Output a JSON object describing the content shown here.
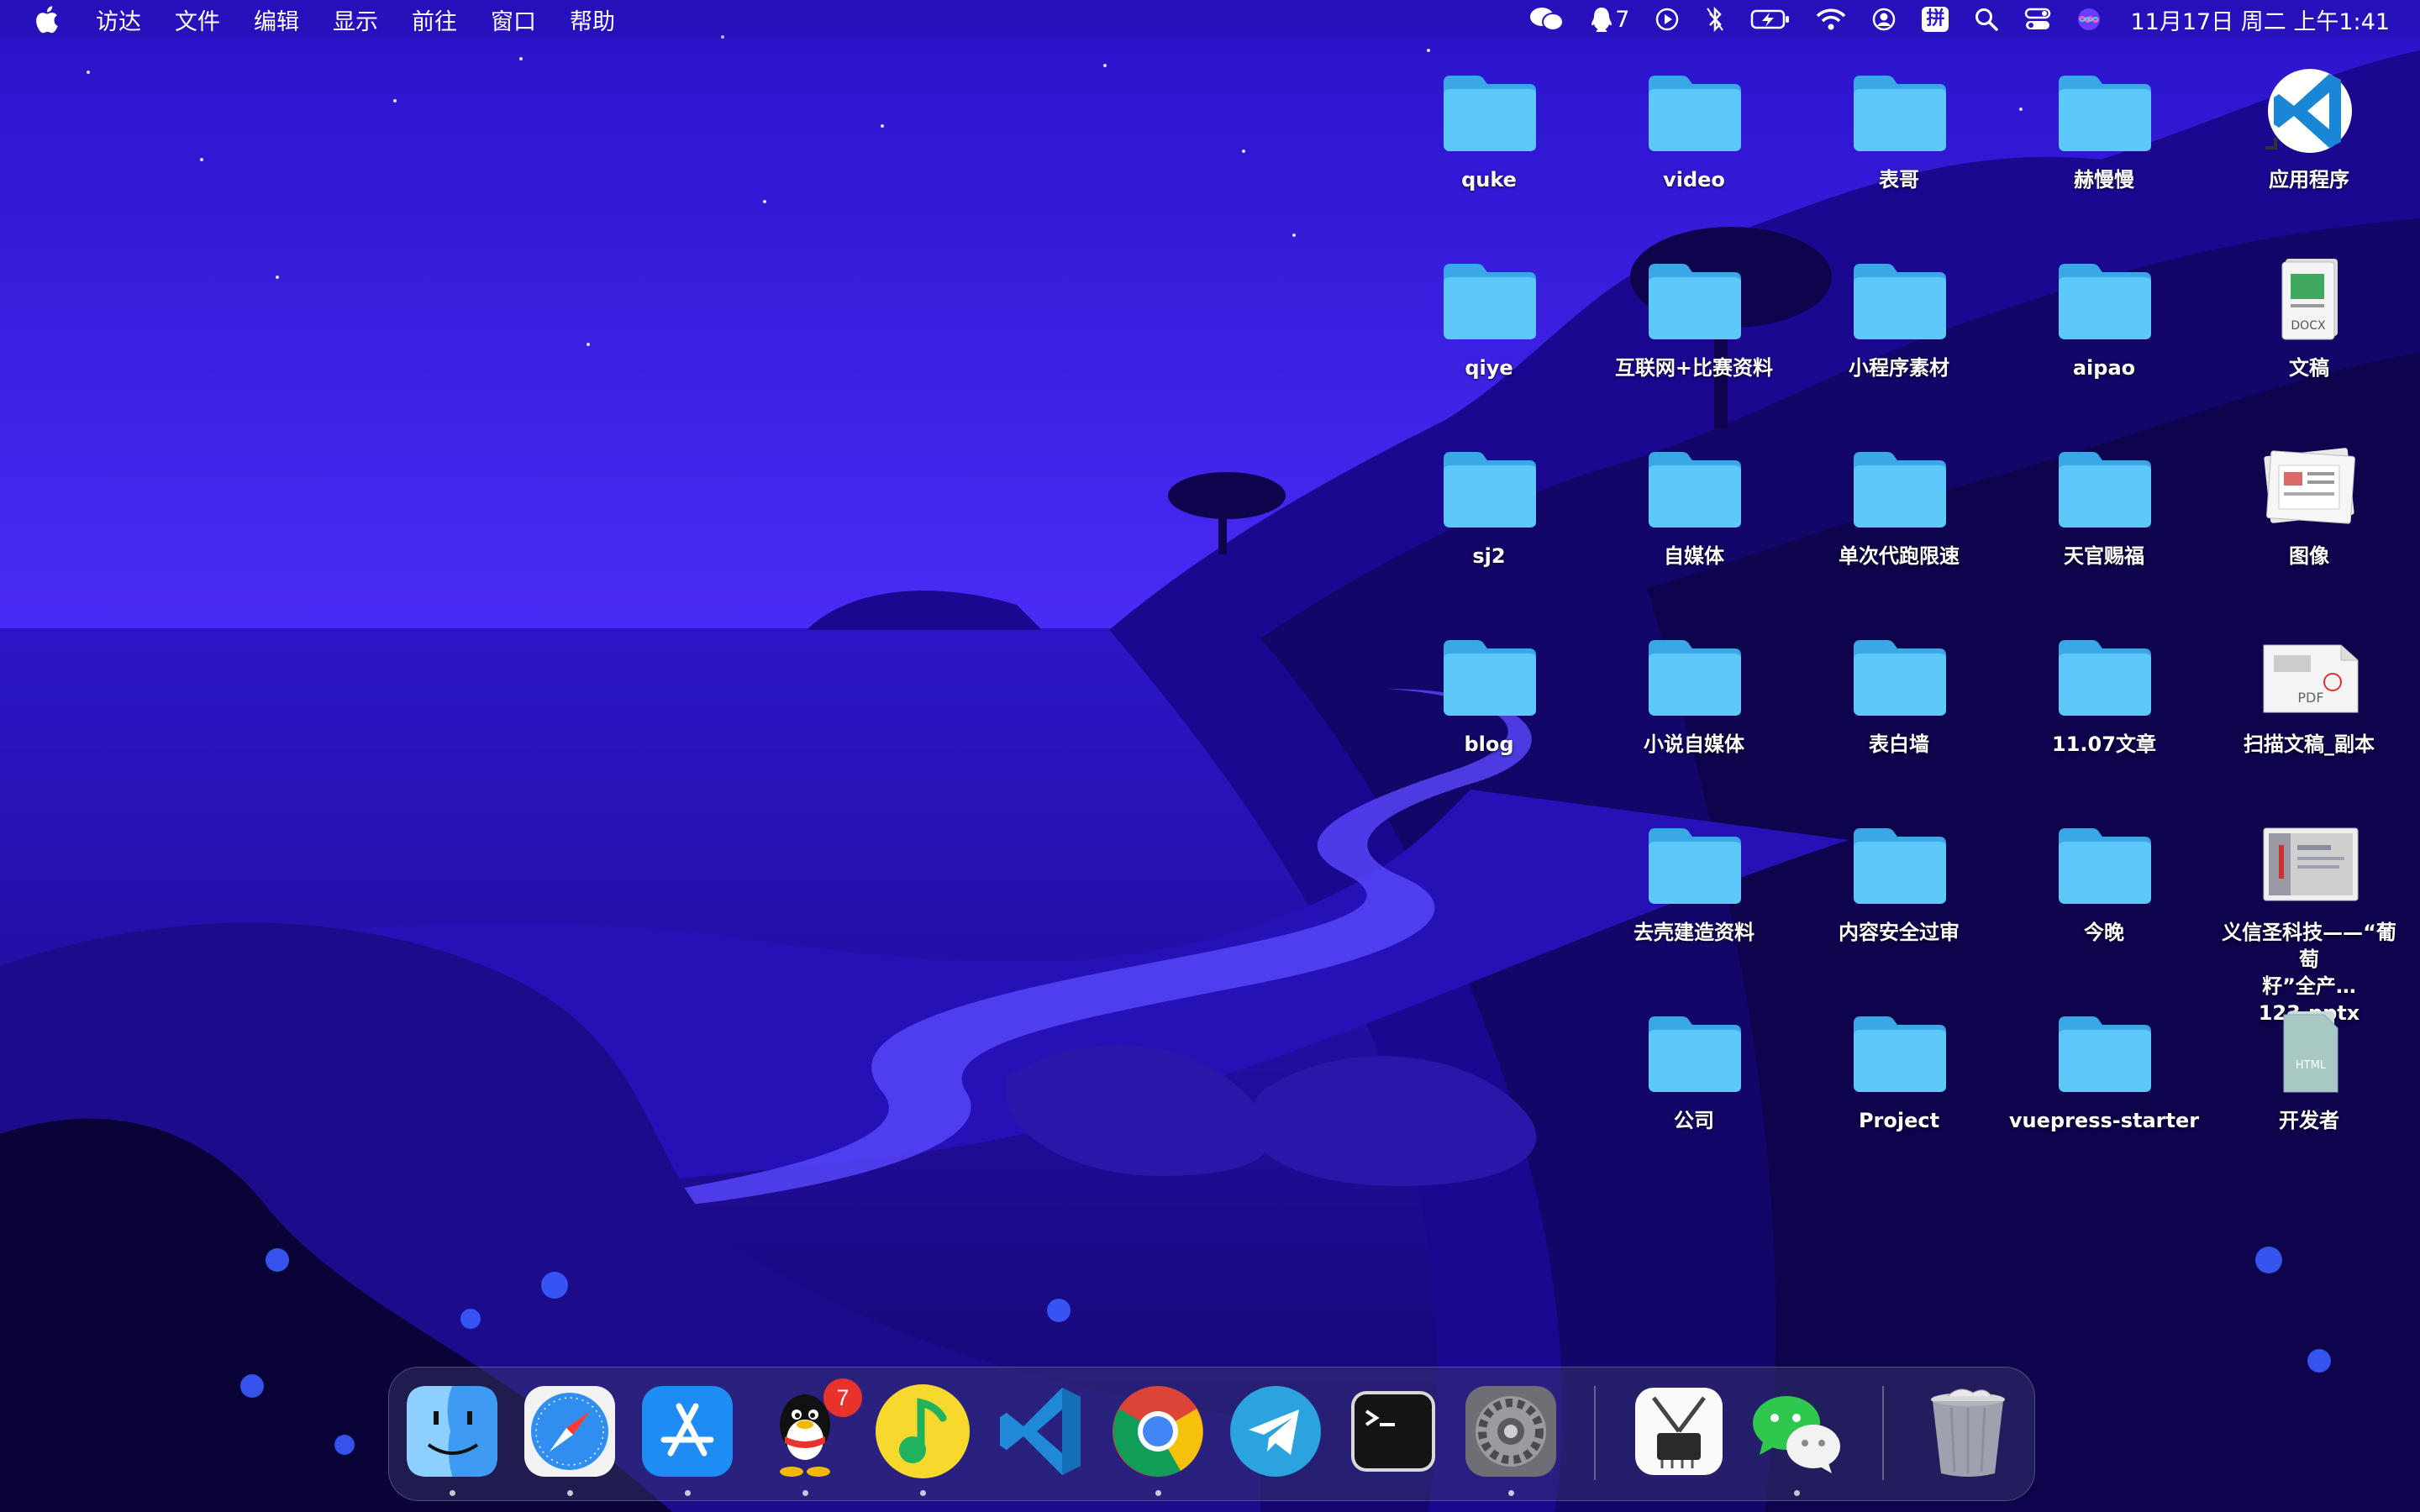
{
  "menubar": {
    "apple_icon": "apple-logo-icon",
    "menus": [
      "访达",
      "文件",
      "编辑",
      "显示",
      "前往",
      "窗口",
      "帮助"
    ],
    "status": {
      "notification_count": "7",
      "input_method": "拼",
      "datetime": "11月17日 周二 上午1:41"
    }
  },
  "desktop": {
    "items": [
      {
        "label": "quke",
        "icon": "folder-icon"
      },
      {
        "label": "video",
        "icon": "folder-icon"
      },
      {
        "label": "表哥",
        "icon": "folder-icon"
      },
      {
        "label": "赫慢慢",
        "icon": "folder-icon"
      },
      {
        "label": "应用程序",
        "icon": "vscode-alias-icon"
      },
      {
        "label": "qiye",
        "icon": "folder-icon"
      },
      {
        "label": "互联网+比赛资料",
        "icon": "folder-icon"
      },
      {
        "label": "小程序素材",
        "icon": "folder-icon"
      },
      {
        "label": "aipao",
        "icon": "folder-icon"
      },
      {
        "label": "文稿",
        "icon": "docx-stack-icon",
        "sublabel": "DOCX"
      },
      {
        "label": "sj2",
        "icon": "folder-icon"
      },
      {
        "label": "自媒体",
        "icon": "folder-icon"
      },
      {
        "label": "单次代跑限速",
        "icon": "folder-icon"
      },
      {
        "label": "天官赐福",
        "icon": "folder-icon"
      },
      {
        "label": "图像",
        "icon": "image-stack-icon"
      },
      {
        "label": "blog",
        "icon": "folder-icon"
      },
      {
        "label": "小说自媒体",
        "icon": "folder-icon"
      },
      {
        "label": "表白墙",
        "icon": "folder-icon"
      },
      {
        "label": "11.07文章",
        "icon": "folder-icon"
      },
      {
        "label": "扫描文稿_副本",
        "icon": "pdf-file-icon",
        "sublabel": "PDF"
      },
      {
        "label": "去壳建造资料",
        "icon": "folder-icon"
      },
      {
        "label": "内容安全过审",
        "icon": "folder-icon"
      },
      {
        "label": "今晚",
        "icon": "folder-icon"
      },
      {
        "label": "义信圣科技——“葡萄籽”全产…123.pptx",
        "label_line1": "义信圣科技——“葡萄",
        "label_line2": "籽”全产…123.pptx",
        "icon": "pptx-file-icon"
      },
      {
        "label": "公司",
        "icon": "folder-icon"
      },
      {
        "label": "Project",
        "icon": "folder-icon"
      },
      {
        "label": "vuepress-starter",
        "icon": "folder-icon"
      },
      {
        "label": "开发者",
        "icon": "html-stack-icon",
        "sublabel": "HTML"
      }
    ]
  },
  "dock": {
    "apps": [
      {
        "name": "finder-icon",
        "running": true
      },
      {
        "name": "safari-icon",
        "running": true
      },
      {
        "name": "app-store-icon",
        "running": true
      },
      {
        "name": "qq-icon",
        "running": true,
        "badge": "7"
      },
      {
        "name": "qq-music-icon",
        "running": true
      },
      {
        "name": "vscode-icon",
        "running": false
      },
      {
        "name": "chrome-icon",
        "running": true
      },
      {
        "name": "telegram-icon",
        "running": false
      },
      {
        "name": "terminal-icon",
        "running": false
      },
      {
        "name": "system-preferences-icon",
        "running": true
      },
      {
        "name": "ic-tool-icon",
        "running": false
      },
      {
        "name": "wechat-icon",
        "running": true
      },
      {
        "name": "trash-icon",
        "running": false
      }
    ]
  },
  "colors": {
    "folder": "#5ec8fb",
    "folder_dark": "#3aa7e6",
    "sky_top": "#3a1fe0",
    "sky_bottom": "#4a2cf8",
    "sea": "#2410b8"
  }
}
